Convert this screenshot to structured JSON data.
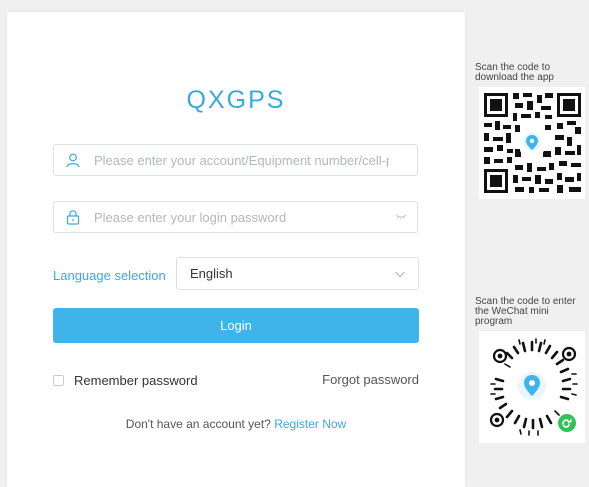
{
  "login": {
    "brand": "QXGPS",
    "account_placeholder": "Please enter your account/Equipment number/cell-p",
    "password_placeholder": "Please enter your login password",
    "language_label": "Language selection",
    "language_value": "English",
    "login_button": "Login",
    "remember_label": "Remember password",
    "forgot_label": "Forgot password",
    "register_prompt": "Don't have an account yet?",
    "register_link": "Register Now"
  },
  "qr": {
    "app": {
      "line1": "Scan the code to",
      "line2": "download the app"
    },
    "wechat": {
      "line1": "Scan the code to enter",
      "line2": "the WeChat mini",
      "line3": "program"
    }
  },
  "colors": {
    "accent": "#3ba9dd",
    "button": "#3eb4ea",
    "wechat_green": "#2fc35a"
  },
  "icons": [
    "user-icon",
    "lock-icon",
    "eye-off-icon",
    "chevron-down-icon",
    "qr-code-icon",
    "wechat-logo-icon"
  ]
}
